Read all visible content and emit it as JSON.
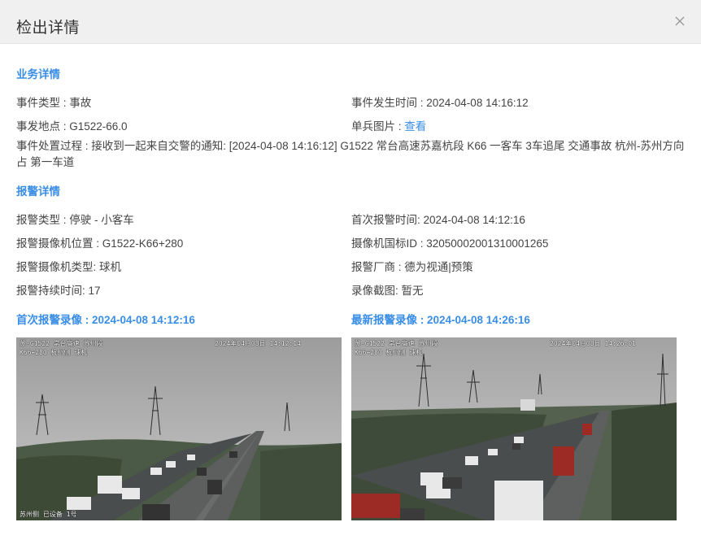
{
  "dialog": {
    "title": "检出详情"
  },
  "business": {
    "section_title": "业务详情",
    "event_type_label": "事件类型 : ",
    "event_type": "事故",
    "event_time_label": "事件发生时间 : ",
    "event_time": "2024-04-08 14:16:12",
    "location_label": "事发地点 : ",
    "location": "G1522-66.0",
    "photo_label": "单兵图片 : ",
    "photo_link": "查看",
    "process_label": "事件处置过程 : ",
    "process": "接收到一起来自交警的通知: [2024-04-08 14:16:12] G1522 常台高速苏嘉杭段 K66 一客车 3车追尾 交通事故 杭州-苏州方向 占 第一车道"
  },
  "alarm": {
    "section_title": "报警详情",
    "alarm_type_label": "报警类型 : ",
    "alarm_type": "停驶 - 小客车",
    "first_time_label": "首次报警时间: ",
    "first_time": "2024-04-08 14:12:16",
    "cam_location_label": "报警摄像机位置 : ",
    "cam_location": "G1522-K66+280",
    "cam_id_label": "摄像机国标ID : ",
    "cam_id": "32050002001310001265",
    "cam_type_label": "报警摄像机类型: ",
    "cam_type": "球机",
    "vendor_label": "报警厂商 : ",
    "vendor": "德为视通|预策",
    "duration_label": "报警持续时间: ",
    "duration": "17",
    "snapshot_label": "录像截图: ",
    "snapshot": "暂无"
  },
  "videos": {
    "first_title": "首次报警录像 : 2024-04-08 14:12:16",
    "latest_title": "最新报警录像 : 2024-04-08 14:26:16",
    "first_osd": {
      "top_left": "苏-G1522 常台高速 苏州段",
      "top_right": "2024年04月08日 14:12:14",
      "line2": "K66+280 杭州侧 球机",
      "bottom_left": "苏州侧 已设备 1号"
    },
    "latest_osd": {
      "top_left": "苏-G1522 常台高速 苏州段",
      "top_right": "2024年04月08日 14:26:01",
      "line2": "K66+280 杭州侧 球机"
    }
  },
  "icons": {
    "close": "close-icon"
  },
  "colors": {
    "accent": "#3a8ee6",
    "header_bg": "#f0f0f0",
    "text": "#444444"
  }
}
